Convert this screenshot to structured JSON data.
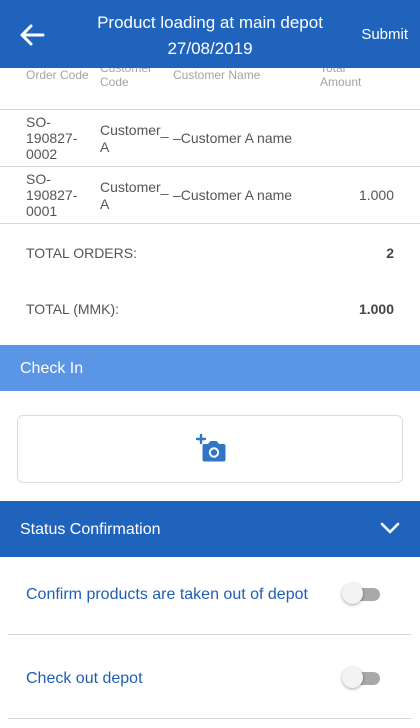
{
  "header": {
    "title_line1": "Product loading at main depot",
    "title_line2": "27/08/2019",
    "submit_label": "Submit",
    "back_icon": "arrow-left-icon"
  },
  "table": {
    "columns": [
      "Order Code",
      "Customer Code",
      "Customer Name",
      "Total Amount"
    ],
    "rows": [
      {
        "code": "SO-190827-0002",
        "code_lines": [
          "SO-",
          "190827-",
          "0002"
        ],
        "customer_code": "Customer_A",
        "customer_code_lines": [
          "Customer_",
          "A"
        ],
        "customer_name": "–Customer A name",
        "amount": ""
      },
      {
        "code": "SO-190827-0001",
        "code_lines": [
          "SO-",
          "190827-",
          "0001"
        ],
        "customer_code": "Customer_A",
        "customer_code_lines": [
          "Customer_",
          "A"
        ],
        "customer_name": "–Customer A name",
        "amount": "1.000"
      }
    ]
  },
  "totals": {
    "orders_label": "TOTAL ORDERS:",
    "orders_value": "2",
    "mmk_label": "TOTAL (MMK):",
    "mmk_value": "1.000"
  },
  "check_in": {
    "label": "Check In",
    "photo_icon": "add-photo-icon"
  },
  "status_confirmation": {
    "label": "Status Confirmation",
    "chevron_icon": "chevron-down-icon",
    "items": [
      {
        "label": "Confirm products are taken out of depot",
        "checked": false
      },
      {
        "label": "Check out depot",
        "checked": false
      }
    ]
  },
  "colors": {
    "primary": "#2063bd",
    "check_in_bar": "#5b95e6",
    "link_text": "#1f5fb3"
  }
}
